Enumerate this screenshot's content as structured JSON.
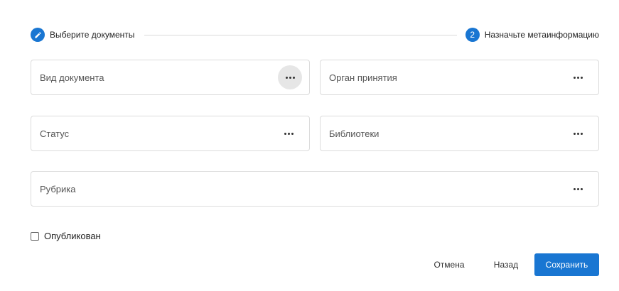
{
  "stepper": {
    "step1": {
      "label": "Выберите документы",
      "icon": "pencil-icon"
    },
    "step2": {
      "number": "2",
      "label": "Назначьте метаинформацию"
    }
  },
  "fields": {
    "vid": {
      "label": "Вид документа",
      "button_icon": "more-horizontal-icon"
    },
    "organ": {
      "label": "Орган принятия",
      "button_icon": "more-horizontal-icon"
    },
    "status": {
      "label": "Статус",
      "button_icon": "more-horizontal-icon"
    },
    "libraries": {
      "label": "Библиотеки",
      "button_icon": "more-horizontal-icon"
    },
    "rubric": {
      "label": "Рубрика",
      "button_icon": "more-horizontal-icon"
    }
  },
  "published": {
    "label": "Опубликован",
    "checked": false
  },
  "actions": {
    "cancel": "Отмена",
    "back": "Назад",
    "save": "Сохранить"
  },
  "colors": {
    "accent": "#1976d2",
    "border": "#dcdcdc",
    "hover": "#e6e6e6"
  }
}
